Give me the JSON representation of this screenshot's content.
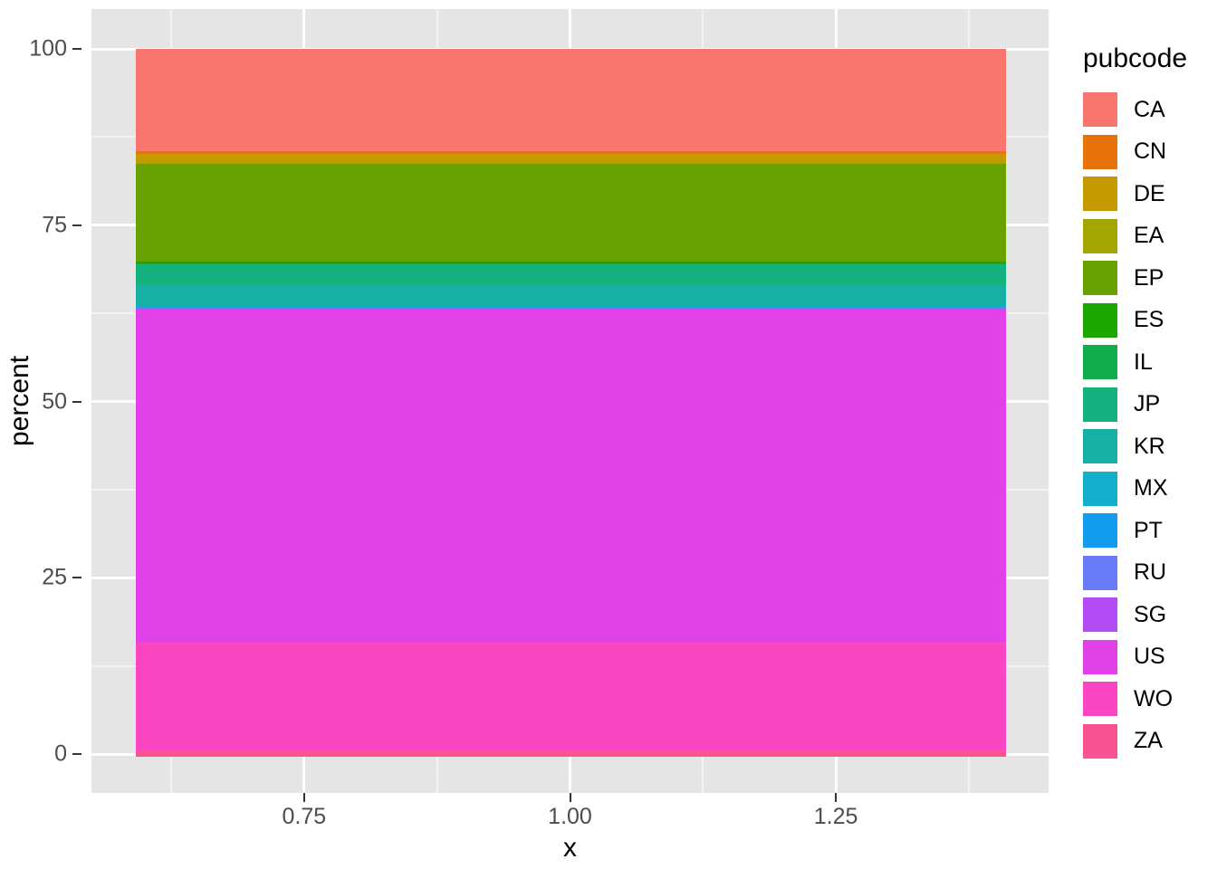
{
  "chart_data": {
    "type": "bar",
    "title": "",
    "xlabel": "x",
    "ylabel": "percent",
    "grid": true,
    "legend_position": "right",
    "legend_title": "pubcode",
    "stacked": true,
    "orientation": "vertical",
    "x": [
      1.0
    ],
    "bar_x_range": [
      0.55,
      1.45
    ],
    "xlim": [
      0.55,
      1.45
    ],
    "ylim": [
      0,
      100
    ],
    "x_ticks": [
      0.75,
      1.0,
      1.25
    ],
    "x_tick_labels": [
      "0.75",
      "1.00",
      "1.25"
    ],
    "y_ticks": [
      0,
      25,
      50,
      75,
      100
    ],
    "y_tick_labels": [
      "0",
      "25",
      "50",
      "75",
      "100"
    ],
    "categories": [
      "CA",
      "CN",
      "DE",
      "EA",
      "EP",
      "ES",
      "IL",
      "JP",
      "KR",
      "MX",
      "PT",
      "RU",
      "SG",
      "US",
      "WO",
      "ZA"
    ],
    "values": [
      14.5,
      0.4,
      1.3,
      0.15,
      13.8,
      0.25,
      0.15,
      2.9,
      2.85,
      0.3,
      0.12,
      0.1,
      0.1,
      47.2,
      15.4,
      0.9
    ],
    "stack_order_top_to_bottom": [
      "CA",
      "CN",
      "DE",
      "EA",
      "EP",
      "ES",
      "IL",
      "JP",
      "KR",
      "MX",
      "PT",
      "RU",
      "SG",
      "US",
      "WO",
      "ZA"
    ],
    "colors": [
      "#F8766D",
      "#E8720C",
      "#C49A00",
      "#A3A500",
      "#69A102",
      "#1CA700",
      "#12AB4C",
      "#15B27F",
      "#16B0A5",
      "#14AECD",
      "#149CEE",
      "#6A7BF9",
      "#B34CF7",
      "#E042E8",
      "#FA46C0",
      "#FA5391"
    ]
  },
  "legend": {
    "title": "pubcode",
    "items": [
      {
        "label": "CA",
        "color": "#F8766D"
      },
      {
        "label": "CN",
        "color": "#E8720C"
      },
      {
        "label": "DE",
        "color": "#C49A00"
      },
      {
        "label": "EA",
        "color": "#A3A500"
      },
      {
        "label": "EP",
        "color": "#69A102"
      },
      {
        "label": "ES",
        "color": "#1CA700"
      },
      {
        "label": "IL",
        "color": "#12AB4C"
      },
      {
        "label": "JP",
        "color": "#15B27F"
      },
      {
        "label": "KR",
        "color": "#16B0A5"
      },
      {
        "label": "MX",
        "color": "#14AECD"
      },
      {
        "label": "PT",
        "color": "#149CEE"
      },
      {
        "label": "RU",
        "color": "#6A7BF9"
      },
      {
        "label": "SG",
        "color": "#B34CF7"
      },
      {
        "label": "US",
        "color": "#E042E8"
      },
      {
        "label": "WO",
        "color": "#FA46C0"
      },
      {
        "label": "ZA",
        "color": "#FA5391"
      }
    ]
  },
  "axes": {
    "y_title": "percent",
    "x_title": "x",
    "y_tick_labels": [
      "100",
      "75",
      "50",
      "25",
      "0"
    ],
    "x_tick_labels": [
      "0.75",
      "1.00",
      "1.25"
    ]
  },
  "theme": {
    "panel_background": "#e5e5e5",
    "major_grid": "#ffffff",
    "minor_grid": "#f2f2f2",
    "text_color": "#4d4d4d",
    "title_color": "#000000"
  }
}
